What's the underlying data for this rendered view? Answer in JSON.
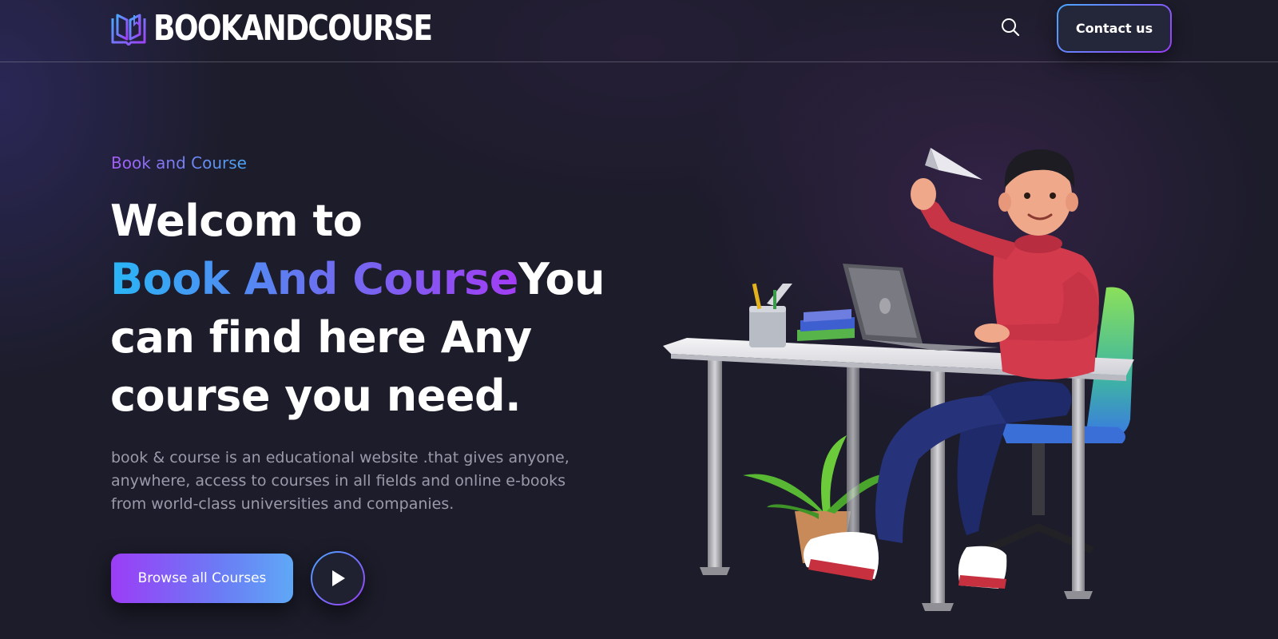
{
  "brand": {
    "name": "BOOKANDCOURSE",
    "icon": "open-book-icon"
  },
  "nav": {
    "search_icon": "search-icon",
    "contact_label": "Contact us"
  },
  "hero": {
    "eyebrow": "Book and Course",
    "headline_line1": "Welcom to",
    "headline_highlight": "Book And Course",
    "headline_rest_1": "You",
    "headline_rest_2": "can find here Any",
    "headline_rest_3": "course you need.",
    "description": "book & course is an educational website .that gives anyone, anywhere, access to courses in all fields and online e-books from world-class universities and companies.",
    "browse_label": "Browse all Courses",
    "play_icon": "play-icon",
    "illustration": "student-at-desk-illustration"
  },
  "colors": {
    "background": "#1c1c2a",
    "accent_purple": "#9b3df6",
    "accent_blue": "#29b6f6",
    "text_muted": "#9a9aaa"
  }
}
